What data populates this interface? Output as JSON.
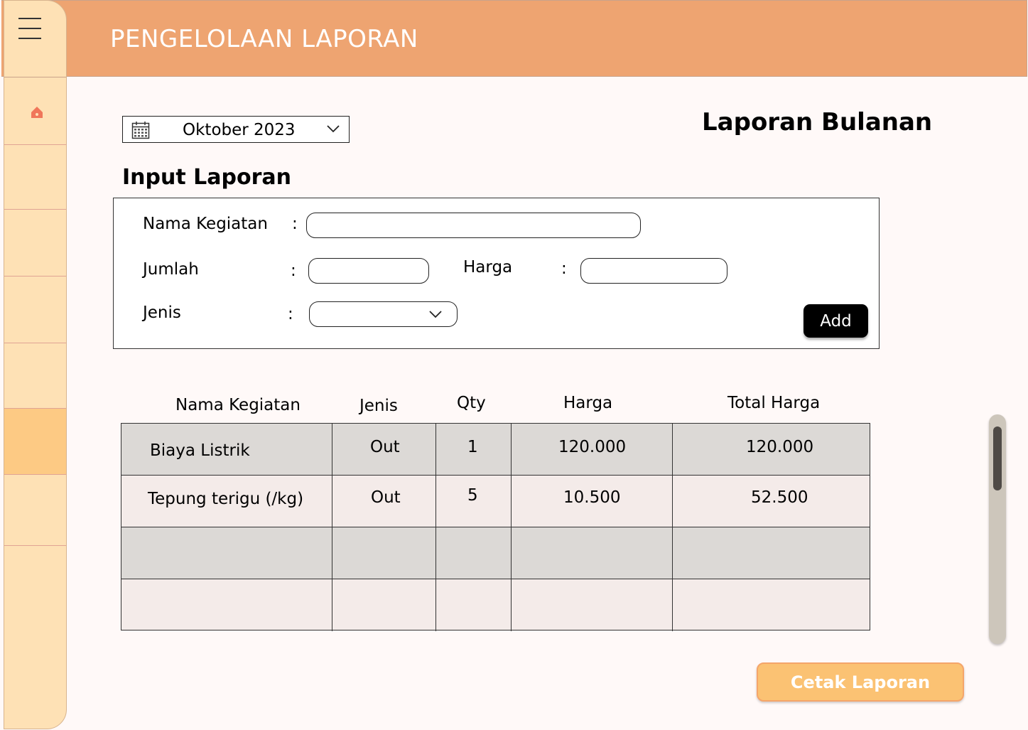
{
  "header": {
    "title": "PENGELOLAAN LAPORAN"
  },
  "sidebar": {
    "menu_icon": "hamburger-icon",
    "home_icon": "home-icon",
    "home_color": "#f0765a"
  },
  "filter": {
    "calendar_icon": "calendar-icon",
    "month": "Oktober 2023"
  },
  "report_title": "Laporan Bulanan",
  "form": {
    "title": "Input Laporan",
    "nama_label": "Nama Kegiatan",
    "jumlah_label": "Jumlah",
    "harga_label": "Harga",
    "jenis_label": "Jenis",
    "colon": ":",
    "nama_value": "",
    "jumlah_value": "",
    "harga_value": "",
    "jenis_value": "",
    "add_label": "Add"
  },
  "table": {
    "headers": [
      "Nama Kegiatan",
      "Jenis",
      "Qty",
      "Harga",
      "Total Harga"
    ],
    "rows": [
      [
        "Biaya Listrik",
        "Out",
        "1",
        "120.000",
        "120.000"
      ],
      [
        "Tepung terigu (/kg)",
        "Out",
        "5",
        "10.500",
        "52.500"
      ],
      [
        "",
        "",
        "",
        "",
        ""
      ],
      [
        "",
        "",
        "",
        "",
        ""
      ]
    ]
  },
  "print_label": "Cetak Laporan",
  "colors": {
    "header": "#eea471",
    "sidebar": "#fee1b5",
    "sidebar_active": "#fdca84",
    "print_button": "#fbc273"
  }
}
